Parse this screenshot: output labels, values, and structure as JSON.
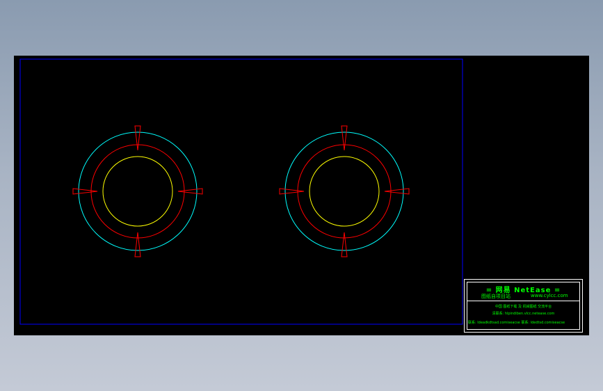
{
  "colors": {
    "drawing_background": "#000000",
    "frame": "#0000ff",
    "outer_circle": "#00ffff",
    "middle_circle": "#ff0000",
    "inner_circle": "#ffff00",
    "markers": "#ff0000",
    "title_text": "#00ff00",
    "title_border": "#ffffff"
  },
  "title_block": {
    "line1": "= 网易 NetEase =",
    "line2_left": "图纸自项目站",
    "line2_right": "www.cylcc.com",
    "line3": "中国 图纸下载 及 机械图纸 交流平台",
    "line4": "清联系: hlpindiben.vlcc.netease.com",
    "line5": "联系: ldeadkdtsad.comiseacse  联系: ldedtsd.comiseacse"
  }
}
